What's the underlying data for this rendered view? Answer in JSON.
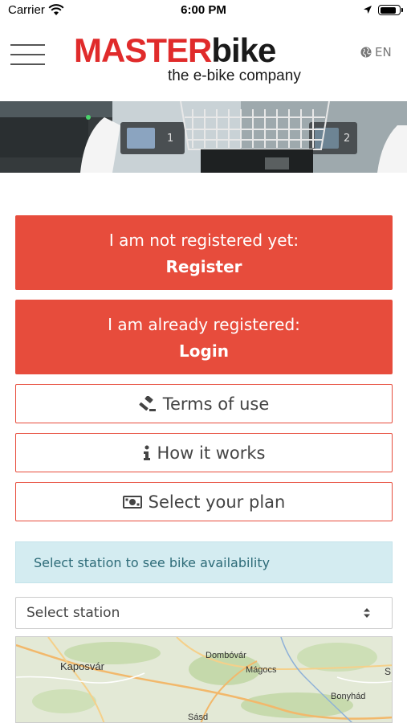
{
  "status_bar": {
    "carrier": "Carrier",
    "time": "6:00 PM",
    "battery_level": 0.9
  },
  "header": {
    "logo": {
      "word_red": "MASTER",
      "word_dark": "bike",
      "tagline": "the e-bike company"
    },
    "language": "EN",
    "icons": {
      "menu": "hamburger-menu-icon",
      "language": "globe-icon"
    }
  },
  "actions": {
    "register": {
      "line1": "I am not registered yet:",
      "line2": "Register"
    },
    "login": {
      "line1": "I am already registered:",
      "line2": "Login"
    },
    "terms": {
      "label": "Terms of use",
      "icon": "gavel-icon"
    },
    "how": {
      "label": "How it works",
      "icon": "info-icon"
    },
    "plan": {
      "label": "Select your plan",
      "icon": "money-icon"
    }
  },
  "station": {
    "info": "Select station to see bike availability",
    "select_value": "Select station"
  },
  "map": {
    "labels": [
      "Kaposvár",
      "Dombóvár",
      "Mágocs",
      "Bonyhád",
      "Sásd",
      "S"
    ]
  },
  "colors": {
    "brand_red": "#e74c3c",
    "info_bg": "#d4ecf1",
    "info_text": "#2d6b78"
  }
}
